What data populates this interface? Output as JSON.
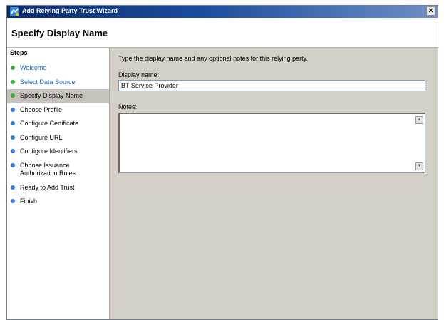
{
  "window": {
    "title": "Add Relying Party Trust Wizard",
    "close_symbol": "×"
  },
  "header": {
    "title": "Specify Display Name"
  },
  "steps": {
    "title": "Steps",
    "items": [
      {
        "label": "Welcome",
        "status": "done"
      },
      {
        "label": "Select Data Source",
        "status": "done"
      },
      {
        "label": "Specify Display Name",
        "status": "current"
      },
      {
        "label": "Choose Profile",
        "status": "pending"
      },
      {
        "label": "Configure Certificate",
        "status": "pending"
      },
      {
        "label": "Configure URL",
        "status": "pending"
      },
      {
        "label": "Configure Identifiers",
        "status": "pending"
      },
      {
        "label": "Choose Issuance Authorization Rules",
        "line1": "Choose Issuance",
        "line2": "Authorization Rules",
        "status": "pending"
      },
      {
        "label": "Ready to Add Trust",
        "status": "pending"
      },
      {
        "label": "Finish",
        "status": "pending"
      }
    ]
  },
  "content": {
    "instructions": "Type the display name and any optional notes for this relying party.",
    "display_name_label": "Display name:",
    "display_name_value": "BT Service Provider",
    "notes_label": "Notes:",
    "notes_value": ""
  },
  "colors": {
    "titlebar": "#0b2a6b",
    "done_dot": "#33b133",
    "pending_dot": "#2f7de0",
    "done_text": "#1a63c7",
    "content_bg": "#d4d0c8",
    "current_step_bg": "#c6c3bd"
  }
}
